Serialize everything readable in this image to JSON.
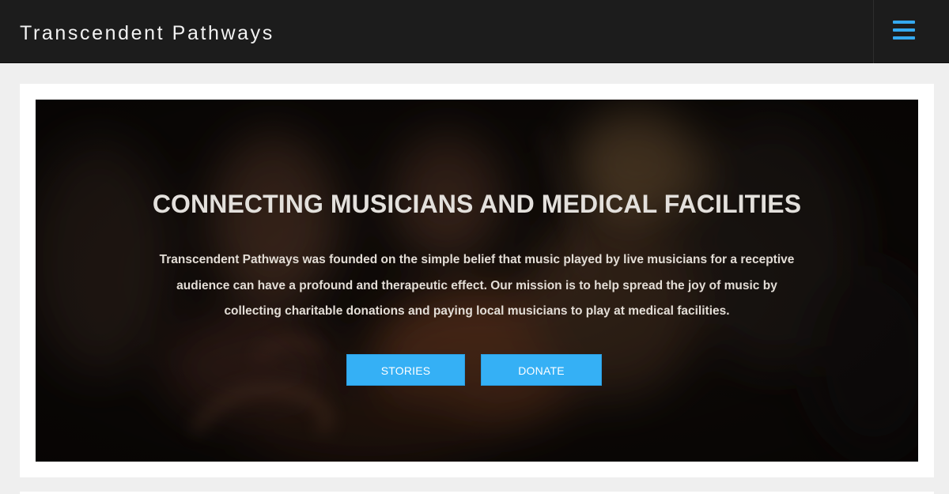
{
  "header": {
    "site_title": "Transcendent Pathways",
    "menu_icon": "hamburger-menu-icon"
  },
  "hero": {
    "title": "CONNECTING MUSICIANS AND MEDICAL FACILITIES",
    "description": "Transcendent Pathways was founded on the simple belief that music played by live musicians for a receptive audience can have a profound and therapeutic effect.  Our mission is to help spread the joy of music by collecting charitable donations and paying local musicians to play at medical facilities.",
    "buttons": [
      {
        "label": "STORIES"
      },
      {
        "label": "DONATE"
      }
    ]
  },
  "colors": {
    "header_bg": "#1c1c1c",
    "accent": "#35b0f5",
    "page_bg": "#efefef"
  }
}
